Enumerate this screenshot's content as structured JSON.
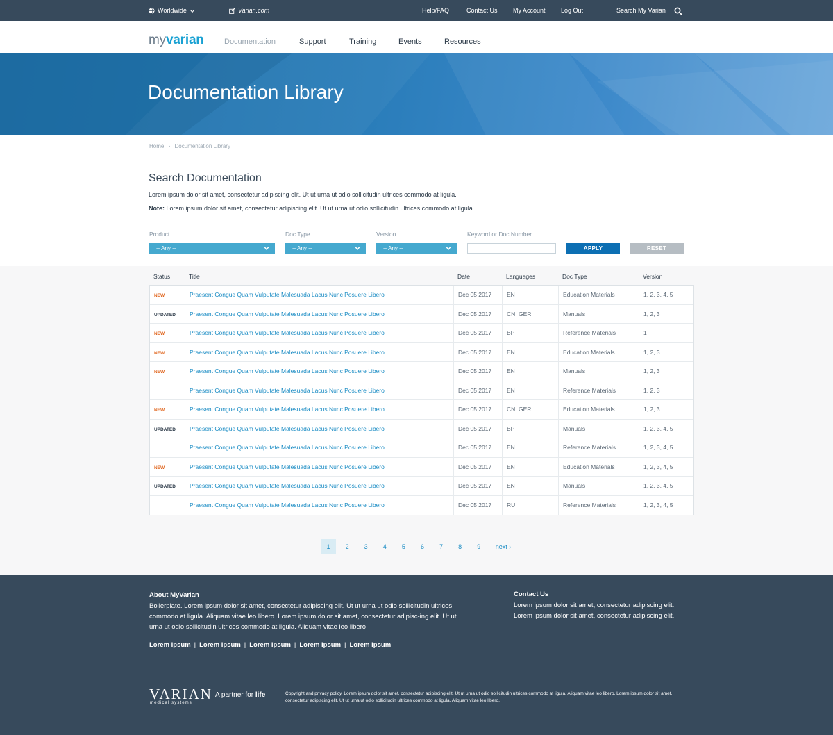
{
  "topbar": {
    "region": "Worldwide",
    "site_link": "Varian.com",
    "links": [
      "Help/FAQ",
      "Contact Us",
      "My Account",
      "Log Out"
    ],
    "search_label": "Search My Varian"
  },
  "nav": {
    "logo_my": "my",
    "logo_varian": "varian",
    "items": [
      "Documentation",
      "Support",
      "Training",
      "Events",
      "Resources"
    ],
    "active_item": "Documentation"
  },
  "hero": {
    "title": "Documentation Library"
  },
  "breadcrumb": {
    "home": "Home",
    "separator": "›",
    "current": "Documentation Library"
  },
  "search": {
    "title": "Search Documentation",
    "intro": "Lorem ipsum dolor sit amet, consectetur adipiscing elit. Ut ut urna ut odio sollicitudin ultrices commodo at ligula.",
    "note_label": "Note:",
    "note_text": " Lorem ipsum dolor sit amet, consectetur adipiscing elit. Ut ut urna ut odio sollicitudin ultrices commodo at ligula.",
    "product_label": "Product",
    "product_value": "-- Any --",
    "doctype_label": "Doc Type",
    "doctype_value": "-- Any --",
    "version_label": "Version",
    "version_value": "-- Any --",
    "keyword_label": "Keyword or Doc Number",
    "keyword_value": "",
    "apply_label": "APPLY",
    "reset_label": "RESET"
  },
  "table": {
    "headers": [
      "Status",
      "Title",
      "Date",
      "Languages",
      "Doc Type",
      "Version"
    ],
    "rows": [
      {
        "status": "NEW",
        "title": "Praesent Congue Quam Vulputate Malesuada Lacus Nunc Posuere Libero",
        "date": "Dec 05 2017",
        "languages": "EN",
        "doc_type": "Education Materials",
        "version": "1, 2, 3, 4, 5"
      },
      {
        "status": "UPDATED",
        "title": "Praesent Congue Quam Vulputate Malesuada Lacus Nunc Posuere Libero",
        "date": "Dec 05 2017",
        "languages": "CN, GER",
        "doc_type": "Manuals",
        "version": "1, 2, 3"
      },
      {
        "status": "NEW",
        "title": "Praesent Congue Quam Vulputate Malesuada Lacus Nunc Posuere Libero",
        "date": "Dec 05 2017",
        "languages": "BP",
        "doc_type": "Reference Materials",
        "version": "1"
      },
      {
        "status": "NEW",
        "title": "Praesent Congue Quam Vulputate Malesuada Lacus Nunc Posuere Libero",
        "date": "Dec 05 2017",
        "languages": "EN",
        "doc_type": "Education Materials",
        "version": "1, 2, 3"
      },
      {
        "status": "NEW",
        "title": "Praesent Congue Quam Vulputate Malesuada Lacus Nunc Posuere Libero",
        "date": "Dec 05 2017",
        "languages": "EN",
        "doc_type": "Manuals",
        "version": "1, 2, 3"
      },
      {
        "status": "",
        "title": "Praesent Congue Quam Vulputate Malesuada Lacus Nunc Posuere Libero",
        "date": "Dec 05 2017",
        "languages": "EN",
        "doc_type": "Reference Materials",
        "version": "1, 2, 3"
      },
      {
        "status": "NEW",
        "title": "Praesent Congue Quam Vulputate Malesuada Lacus Nunc Posuere Libero",
        "date": "Dec 05 2017",
        "languages": "CN, GER",
        "doc_type": "Education Materials",
        "version": "1, 2, 3"
      },
      {
        "status": "UPDATED",
        "title": "Praesent Congue Quam Vulputate Malesuada Lacus Nunc Posuere Libero",
        "date": "Dec 05 2017",
        "languages": "BP",
        "doc_type": "Manuals",
        "version": "1, 2, 3, 4, 5"
      },
      {
        "status": "",
        "title": "Praesent Congue Quam Vulputate Malesuada Lacus Nunc Posuere Libero",
        "date": "Dec 05 2017",
        "languages": "EN",
        "doc_type": "Reference Materials",
        "version": "1, 2, 3, 4, 5"
      },
      {
        "status": "NEW",
        "title": "Praesent Congue Quam Vulputate Malesuada Lacus Nunc Posuere Libero",
        "date": "Dec 05 2017",
        "languages": "EN",
        "doc_type": "Education Materials",
        "version": "1, 2, 3, 4, 5"
      },
      {
        "status": "UPDATED",
        "title": "Praesent Congue Quam Vulputate Malesuada Lacus Nunc Posuere Libero",
        "date": "Dec 05 2017",
        "languages": "EN",
        "doc_type": "Manuals",
        "version": "1, 2, 3, 4, 5"
      },
      {
        "status": "",
        "title": "Praesent Congue Quam Vulputate Malesuada Lacus Nunc Posuere Libero",
        "date": "Dec 05 2017",
        "languages": "RU",
        "doc_type": "Reference Materials",
        "version": "1, 2, 3, 4, 5"
      }
    ]
  },
  "pagination": {
    "pages": [
      "1",
      "2",
      "3",
      "4",
      "5",
      "6",
      "7",
      "8",
      "9"
    ],
    "current": "1",
    "next_label": "next ›"
  },
  "footer": {
    "about_title": "About MyVarian",
    "about_text": "Boilerplate. Lorem ipsum dolor sit amet, consectetur adipiscing elit. Ut ut urna ut odio sollicitudin ultrices commodo at ligula. Aliquam vitae leo libero. Lorem ipsum dolor sit amet, consectetur adipisc-ing elit. Ut ut urna ut odio sollicitudin ultrices commodo at ligula. Aliquam vitae leo libero.",
    "contact_title": "Contact Us",
    "contact_text": "Lorem ipsum dolor sit amet, consectetur adipiscing elit. Lorem ipsum dolor sit amet, consectetur adipiscing elit.",
    "links": [
      "Lorem Ipsum",
      "Lorem Ipsum",
      "Lorem Ipsum",
      "Lorem Ipsum",
      "Lorem Ipsum"
    ],
    "link_separator": "|",
    "logo_word": "VARIAN",
    "logo_sub": "medical systems",
    "tagline_prefix": "A partner for ",
    "tagline_bold": "life",
    "copyright": "Copyright and privacy policy. Lorem ipsum dolor sit amet, consectetur adipiscing elit. Ut ut urna ut odio sollicitudin ultrices commodo at ligula. Aliquam vitae leo libero. Lorem ipsum dolor sit amet, consectetur adipiscing elit. Ut ut urna ut odio sollicitudin ultrices commodo at ligula. Aliquam vitae leo libero."
  },
  "colors": {
    "topbar": "#374a5c",
    "accent": "#19a1d3",
    "link": "#1a8cc4",
    "select": "#45a9cf",
    "apply": "#0d6fb3",
    "reset": "#b6bdc3",
    "status_new": "#e0651d"
  }
}
